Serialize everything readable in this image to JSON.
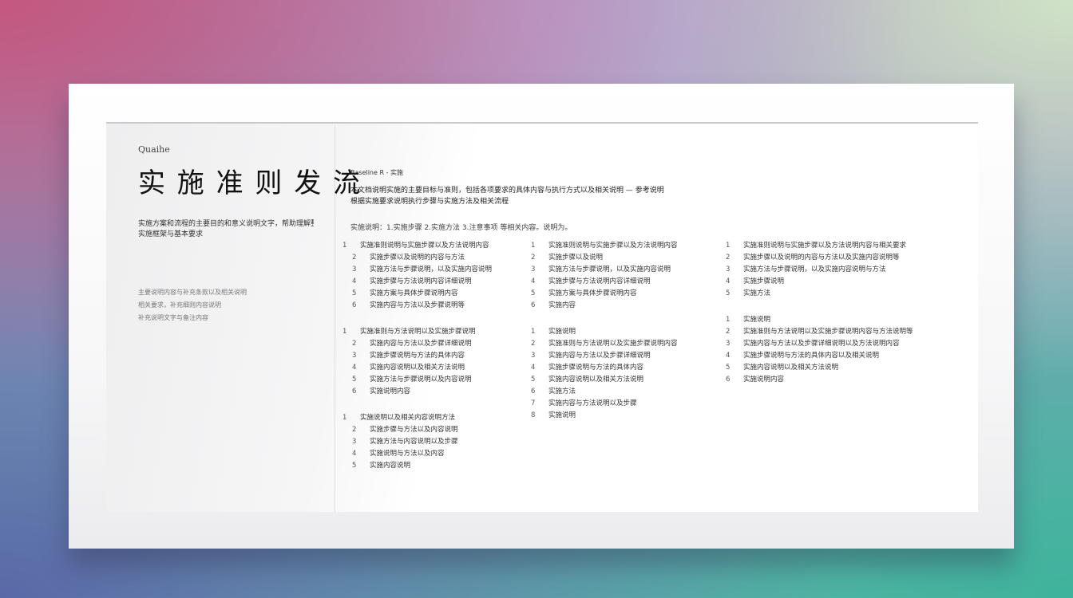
{
  "left": {
    "eyebrow": "Quaihe",
    "title": "实 施 准 则 发 流",
    "desc": [
      "实施方案和流程的主要目的和意义说明文字，帮助理解整体",
      "实施框架与基本要求"
    ],
    "notes": [
      "主要说明内容与补充条款以及相关说明",
      "相关要求，补充细则内容说明",
      "补充说明文字与备注内容"
    ]
  },
  "right": {
    "meta": "Baseline  R - 实施",
    "intro": [
      "本文档说明实施的主要目标与准则，包括各项要求的具体内容与执行方式以及相关说明 — 参考说明",
      "根据实施要求说明执行步骤与实施方法及相关流程"
    ],
    "subhead": "实施说明：1.实施步骤 2.实施方法 3.注意事项 等相关内容。说明为。"
  },
  "columns": [
    {
      "blocks": [
        {
          "rows": [
            {
              "n": "1",
              "t": "实施准则说明与实施步骤以及方法说明内容"
            },
            {
              "n": "2",
              "t": "实施步骤以及说明的内容与方法"
            },
            {
              "n": "3",
              "t": "实施方法与步骤说明，以及实施内容说明"
            },
            {
              "n": "4",
              "t": "实施步骤与方法说明内容详细说明"
            },
            {
              "n": "5",
              "t": "实施方案与具体步骤说明内容"
            },
            {
              "n": "6",
              "t": "实施内容与方法以及步骤说明等"
            }
          ]
        },
        {
          "rows": [
            {
              "n": "1",
              "t": "实施准则与方法说明以及实施步骤说明"
            },
            {
              "n": "2",
              "t": "实施内容与方法以及步骤详细说明"
            },
            {
              "n": "3",
              "t": "实施步骤说明与方法的具体内容"
            },
            {
              "n": "4",
              "t": "实施内容说明以及相关方法说明"
            },
            {
              "n": "5",
              "t": "实施方法与步骤说明以及内容说明"
            },
            {
              "n": "6",
              "t": "实施说明内容"
            }
          ]
        },
        {
          "rows": [
            {
              "n": "1",
              "t": "实施说明以及相关内容说明方法"
            },
            {
              "n": "2",
              "t": "实施步骤与方法以及内容说明"
            },
            {
              "n": "3",
              "t": "实施方法与内容说明以及步骤"
            },
            {
              "n": "4",
              "t": "实施说明与方法以及内容"
            },
            {
              "n": "5",
              "t": "实施内容说明"
            }
          ]
        }
      ]
    },
    {
      "blocks": [
        {
          "rows": [
            {
              "n": "1",
              "t": "实施准则说明与实施步骤以及方法说明内容"
            },
            {
              "n": "2",
              "t": "实施步骤以及说明"
            },
            {
              "n": "3",
              "t": "实施方法与步骤说明，以及实施内容说明"
            },
            {
              "n": "4",
              "t": "实施步骤与方法说明内容详细说明"
            },
            {
              "n": "5",
              "t": "实施方案与具体步骤说明内容"
            },
            {
              "n": "6",
              "t": "实施内容"
            }
          ]
        },
        {
          "rows": [
            {
              "n": "1",
              "t": "实施说明"
            },
            {
              "n": "2",
              "t": "实施准则与方法说明以及实施步骤说明内容"
            },
            {
              "n": "3",
              "t": "实施内容与方法以及步骤详细说明"
            },
            {
              "n": "4",
              "t": "实施步骤说明与方法的具体内容"
            },
            {
              "n": "5",
              "t": "实施内容说明以及相关方法说明"
            },
            {
              "n": "6",
              "t": "实施方法"
            },
            {
              "n": "7",
              "t": "实施内容与方法说明以及步骤"
            },
            {
              "n": "8",
              "t": "实施说明"
            }
          ]
        }
      ]
    },
    {
      "blocks": [
        {
          "rows": [
            {
              "n": "1",
              "t": "实施准则说明与实施步骤以及方法说明内容与相关要求"
            },
            {
              "n": "2",
              "t": "实施步骤以及说明的内容与方法以及实施内容说明等"
            },
            {
              "n": "3",
              "t": "实施方法与步骤说明，以及实施内容说明与方法"
            },
            {
              "n": "4",
              "t": "实施步骤说明"
            },
            {
              "n": "5",
              "t": "实施方法"
            }
          ]
        },
        {
          "rows": [
            {
              "n": "1",
              "t": "实施说明"
            },
            {
              "n": "2",
              "t": "实施准则与方法说明以及实施步骤说明内容与方法说明等"
            },
            {
              "n": "3",
              "t": "实施内容与方法以及步骤详细说明以及方法说明内容"
            },
            {
              "n": "4",
              "t": "实施步骤说明与方法的具体内容以及相关说明"
            },
            {
              "n": "5",
              "t": "实施内容说明以及相关方法说明"
            },
            {
              "n": "6",
              "t": "实施说明内容"
            }
          ]
        }
      ]
    }
  ]
}
